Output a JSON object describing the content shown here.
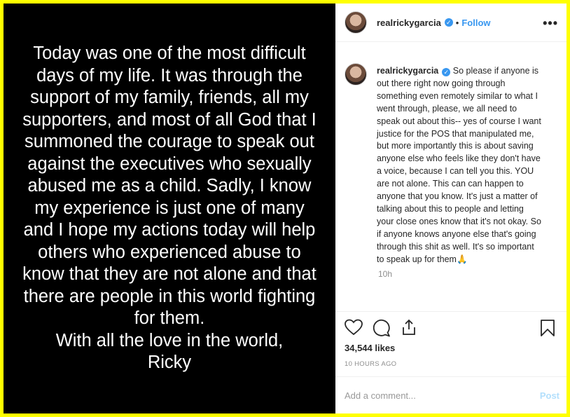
{
  "post_image": {
    "lines": [
      "Today was one of the most difficult",
      "days of my life. It was through the",
      "support of my family, friends, all my",
      "supporters, and most of all God that I",
      "summoned the courage to speak out",
      "against the executives who sexually",
      "abused me as a child. Sadly, I know",
      "my experience is just one of many",
      "and I hope my actions today will help",
      "others who experienced abuse to",
      "know that they are not alone and that",
      "there are people in this world fighting",
      "for them."
    ],
    "signoff_1": "With all the love in the world,",
    "signoff_2": "Ricky"
  },
  "header": {
    "username": "realrickygarcia",
    "separator": "•",
    "follow_label": "Follow",
    "more_label": "•••"
  },
  "caption": {
    "username": "realrickygarcia",
    "text": "So please if anyone is out there right now going through something even remotely similar to what I went through, please, we all need to speak out about this-- yes of course I want justice for the POS that manipulated me, but more importantly this is about saving anyone else who feels like they don't have a voice, because I can tell you this. YOU are not alone. This can can happen to anyone that you know. It's just a matter of talking about this to people and letting your close ones know that it's not okay. So if anyone knows anyone else that's going through this shit as well. It's so important to speak up for them🙏",
    "time_ago": "10h"
  },
  "actions": {
    "likes": "34,544 likes",
    "posted": "10 HOURS AGO"
  },
  "add_comment": {
    "placeholder": "Add a comment...",
    "post_label": "Post"
  },
  "colors": {
    "accent": "#3897f0",
    "border": "#ffff00",
    "post_disabled": "#b2dffc"
  },
  "icons": [
    "heart-icon",
    "comment-icon",
    "share-icon",
    "bookmark-icon",
    "verified-badge-icon",
    "more-options-icon"
  ]
}
